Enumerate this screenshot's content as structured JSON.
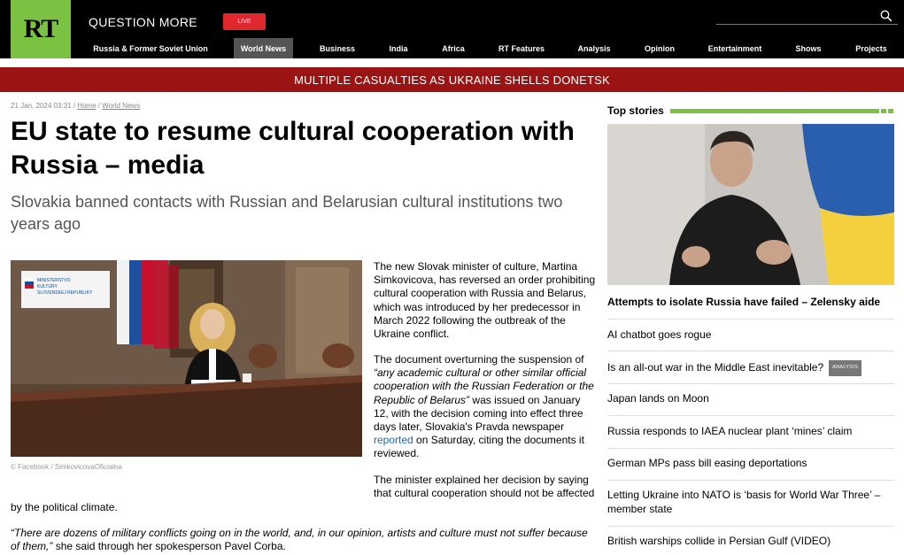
{
  "header": {
    "logo_text": "RT",
    "tagline": "QUESTION MORE",
    "live_label": "LIVE",
    "nav": [
      {
        "label": "Russia & Former Soviet Union",
        "active": false
      },
      {
        "label": "World News",
        "active": true
      },
      {
        "label": "Business",
        "active": false
      },
      {
        "label": "India",
        "active": false
      },
      {
        "label": "Africa",
        "active": false
      },
      {
        "label": "RT Features",
        "active": false
      },
      {
        "label": "Analysis",
        "active": false
      },
      {
        "label": "Opinion",
        "active": false
      },
      {
        "label": "Entertainment",
        "active": false
      },
      {
        "label": "Shows",
        "active": false
      },
      {
        "label": "Projects",
        "active": false
      }
    ]
  },
  "banner": {
    "text": "MULTIPLE CASUALTIES AS UKRAINE SHELLS DONETSK"
  },
  "article": {
    "date": "21 Jan, 2024 03:31",
    "breadcrumb_home": "Home",
    "breadcrumb_section": "World News",
    "title": "EU state to resume cultural cooperation with Russia – media",
    "subtitle": "Slovakia banned contacts with Russian and Belarusian cultural institutions two years ago",
    "photo_caption": "© Facebook / SimkovicovaOficialna",
    "photo_sign_text": "MINISTERSTVO KULTÚRY SLOVENSKEJ REPUBLIKY",
    "p1": "The new Slovak minister of culture, Martina Simkovicova, has reversed an order prohibiting cultural cooperation with Russia and Belarus, which was introduced by her predecessor in March 2022 following the outbreak of the Ukraine conflict.",
    "p2_a": "The document overturning the suspension of ",
    "p2_quote": "“any academic cultural or other similar official cooperation with the Russian Federation or the Republic of Belarus”",
    "p2_b": " was issued on January 12, with the decision coming into effect three days later, Slovakia's Pravda newspaper ",
    "p2_link": "reported",
    "p2_c": " on Saturday, citing the documents it reviewed.",
    "p3_a": "The minister explained her decision by saying that cultural cooperation should not be affected",
    "p3_b": "by the political climate.",
    "p4_quote": "“There are dozens of military conflicts going on in the world, and, in our opinion, artists and culture must not suffer because of them,”",
    "p4_b": " she said through her spokesperson Pavel Corba."
  },
  "sidebar": {
    "title": "Top stories",
    "lead": "Attempts to isolate Russia have failed – Zelensky aide",
    "stories": [
      {
        "text": "AI chatbot goes rogue",
        "badge": ""
      },
      {
        "text": "Is an all-out war in the Middle East inevitable?",
        "badge": "ANALYSIS"
      },
      {
        "text": "Japan lands on Moon",
        "badge": ""
      },
      {
        "text": "Russia responds to IAEA nuclear plant ‘mines’ claim",
        "badge": ""
      },
      {
        "text": "German MPs pass bill easing deportations",
        "badge": ""
      },
      {
        "text": "Letting Ukraine into NATO is ‘basis for World War Three’ – member state",
        "badge": ""
      },
      {
        "text": "British warships collide in Persian Gulf (VIDEO)",
        "badge": ""
      }
    ]
  },
  "colors": {
    "brand_green": "#7bc142",
    "banner_red": "#9a1414",
    "live_red": "#e0272d",
    "link_blue": "#1a66c6"
  }
}
